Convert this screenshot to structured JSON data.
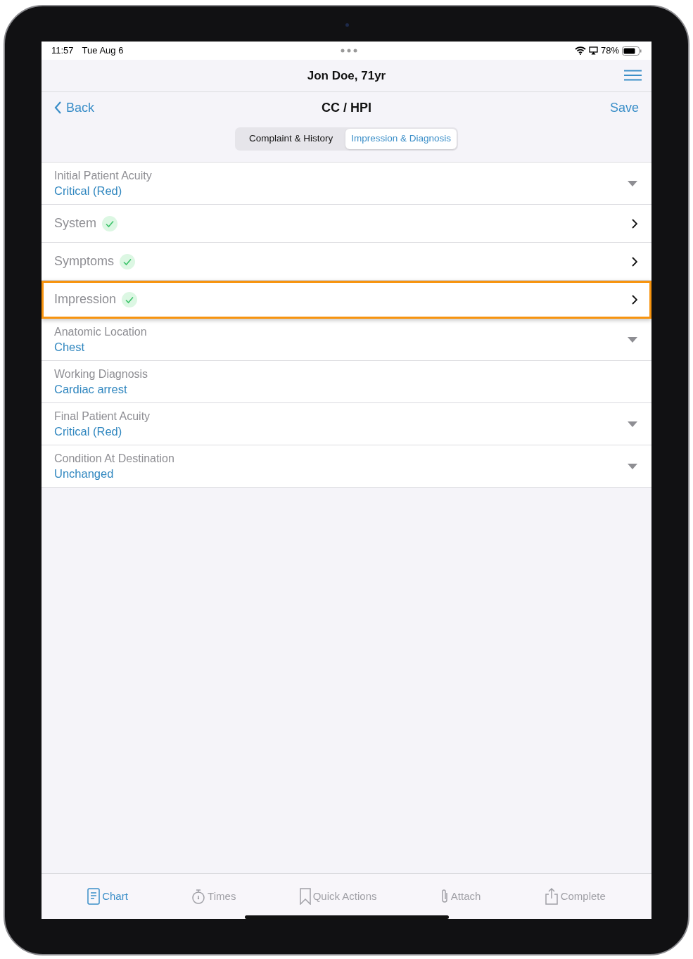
{
  "status_bar": {
    "time": "11:57",
    "date": "Tue Aug 6",
    "battery": "78%"
  },
  "header": {
    "title": "Jon Doe, 71yr"
  },
  "nav": {
    "back": "Back",
    "title": "CC / HPI",
    "action": "Save"
  },
  "segments": [
    {
      "label": "Complaint & History",
      "selected": false
    },
    {
      "label": "Impression & Diagnosis",
      "selected": true
    }
  ],
  "rows": [
    {
      "kind": "dropdown",
      "label": "Initial Patient Acuity",
      "value": "Critical (Red)",
      "highlighted": false
    },
    {
      "kind": "nav",
      "label": "System",
      "complete": true,
      "highlighted": false
    },
    {
      "kind": "nav",
      "label": "Symptoms",
      "complete": true,
      "highlighted": false
    },
    {
      "kind": "nav",
      "label": "Impression",
      "complete": true,
      "highlighted": true
    },
    {
      "kind": "dropdown",
      "label": "Anatomic Location",
      "value": "Chest",
      "highlighted": false
    },
    {
      "kind": "text",
      "label": "Working Diagnosis",
      "value": "Cardiac arrest",
      "highlighted": false
    },
    {
      "kind": "dropdown",
      "label": "Final Patient Acuity",
      "value": "Critical (Red)",
      "highlighted": false
    },
    {
      "kind": "dropdown",
      "label": "Condition At Destination",
      "value": "Unchanged",
      "highlighted": false
    }
  ],
  "tab_bar": [
    {
      "kind": "chart",
      "label": "Chart",
      "selected": true
    },
    {
      "kind": "timer",
      "label": "Times",
      "selected": false
    },
    {
      "kind": "bookmark",
      "label": "Quick Actions",
      "selected": false
    },
    {
      "kind": "attach",
      "label": "Attach",
      "selected": false
    },
    {
      "kind": "share",
      "label": "Complete",
      "selected": false
    }
  ]
}
